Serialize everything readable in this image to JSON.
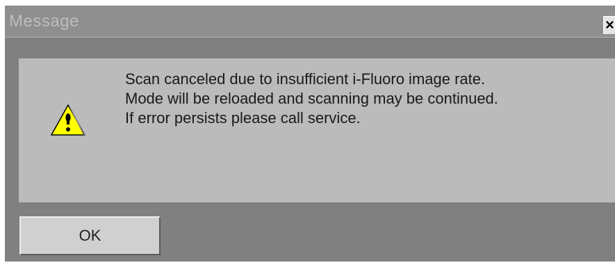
{
  "window": {
    "title": "Message",
    "close_glyph": "×"
  },
  "dialog": {
    "icon": "warning-icon",
    "message_lines": [
      "Scan canceled due to insufficient i-Fluoro image rate.",
      "Mode will be reloaded and scanning may be continued.",
      "If error persists please call service."
    ]
  },
  "buttons": {
    "ok_label": "OK"
  },
  "colors": {
    "frame": "#808080",
    "panel": "#bbbbbb",
    "warning_fill": "#ffff00"
  }
}
